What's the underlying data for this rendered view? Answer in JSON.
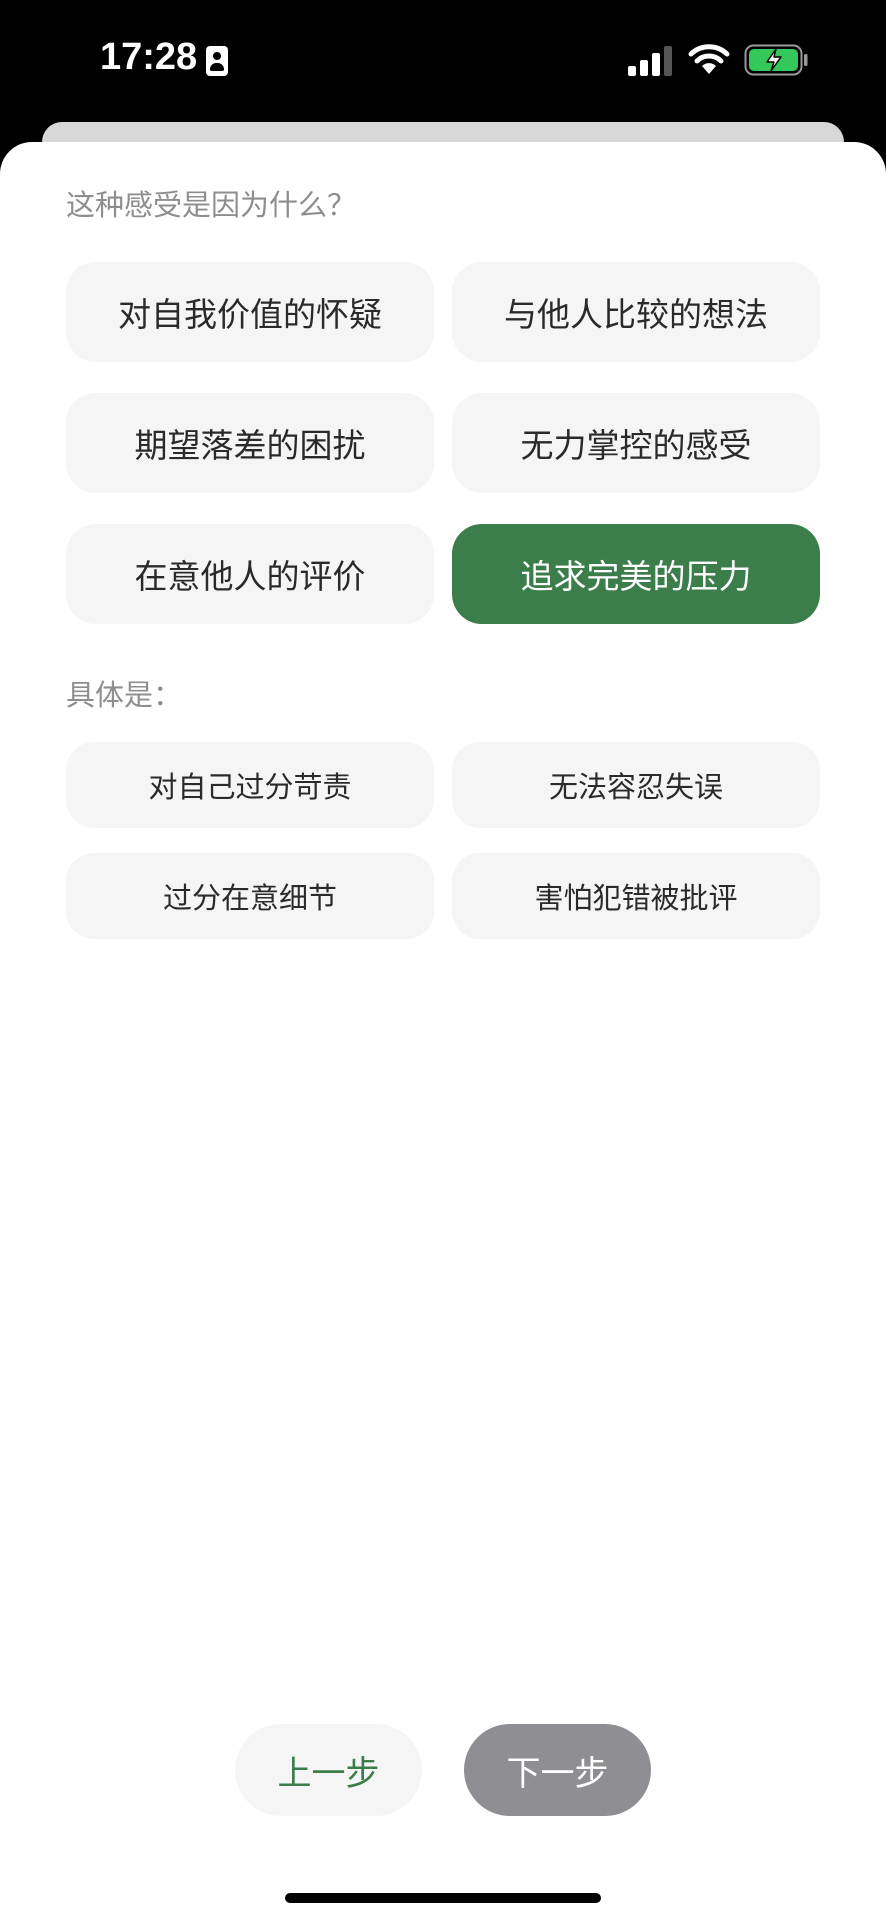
{
  "status_bar": {
    "time": "17:28"
  },
  "question": {
    "label": "这种感受是因为什么？",
    "options": [
      {
        "label": "对自我价值的怀疑",
        "selected": false
      },
      {
        "label": "与他人比较的想法",
        "selected": false
      },
      {
        "label": "期望落差的困扰",
        "selected": false
      },
      {
        "label": "无力掌控的感受",
        "selected": false
      },
      {
        "label": "在意他人的评价",
        "selected": false
      },
      {
        "label": "追求完美的压力",
        "selected": true
      }
    ]
  },
  "detail": {
    "label": "具体是：",
    "options": [
      {
        "label": "对自己过分苛责",
        "selected": false
      },
      {
        "label": "无法容忍失误",
        "selected": false
      },
      {
        "label": "过分在意细节",
        "selected": false
      },
      {
        "label": "害怕犯错被批评",
        "selected": false
      }
    ]
  },
  "navigation": {
    "prev_label": "上一步",
    "next_label": "下一步"
  },
  "colors": {
    "accent": "#3c7d4c",
    "option_bg": "#f5f5f5",
    "disabled_button": "#8e8e93"
  }
}
